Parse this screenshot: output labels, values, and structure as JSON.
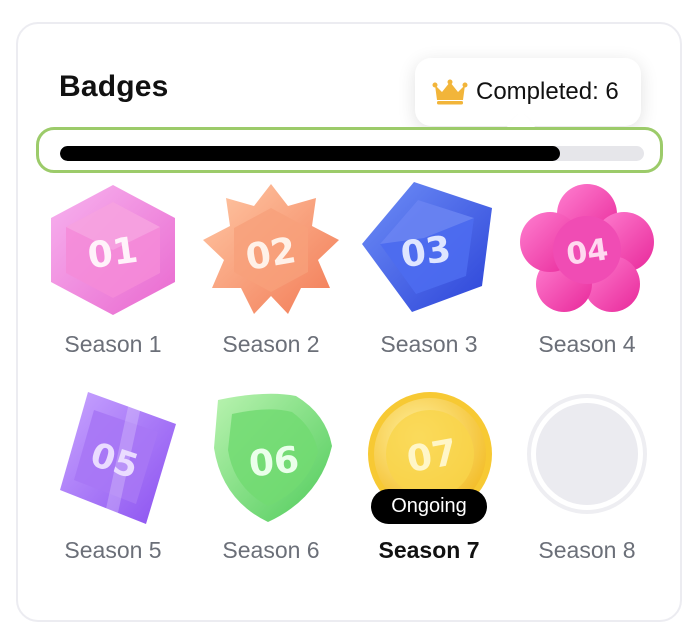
{
  "header": {
    "title": "Badges"
  },
  "summary": {
    "icon": "crown-icon",
    "completed_label": "Completed: 6",
    "crown_color": "#f2b53a"
  },
  "progress": {
    "fraction": 0.857,
    "fill_color": "#000000",
    "frame_color": "#9ccb6a"
  },
  "badges": [
    {
      "label": "Season 1",
      "icon": "hexagon-badge-01-icon",
      "code": "01",
      "status": "completed",
      "color": "#f07ad8"
    },
    {
      "label": "Season 2",
      "icon": "star-badge-02-icon",
      "code": "02",
      "status": "completed",
      "color": "#f59a6a"
    },
    {
      "label": "Season 3",
      "icon": "pentagon-badge-03-icon",
      "code": "03",
      "status": "completed",
      "color": "#3f63f0"
    },
    {
      "label": "Season 4",
      "icon": "flower-badge-04-icon",
      "code": "04",
      "status": "completed",
      "color": "#f24ab8"
    },
    {
      "label": "Season 5",
      "icon": "cube-badge-05-icon",
      "code": "05",
      "status": "completed",
      "color": "#a070f0"
    },
    {
      "label": "Season 6",
      "icon": "shield-badge-06-icon",
      "code": "06",
      "status": "completed",
      "color": "#6ed86e"
    },
    {
      "label": "Season 7",
      "icon": "coin-badge-07-icon",
      "code": "07",
      "status": "ongoing",
      "color": "#f5c832"
    },
    {
      "label": "Season 8",
      "icon": "locked-badge-placeholder-icon",
      "code": "",
      "status": "locked",
      "color": "#ebebf0"
    }
  ],
  "ongoing_tag": "Ongoing"
}
